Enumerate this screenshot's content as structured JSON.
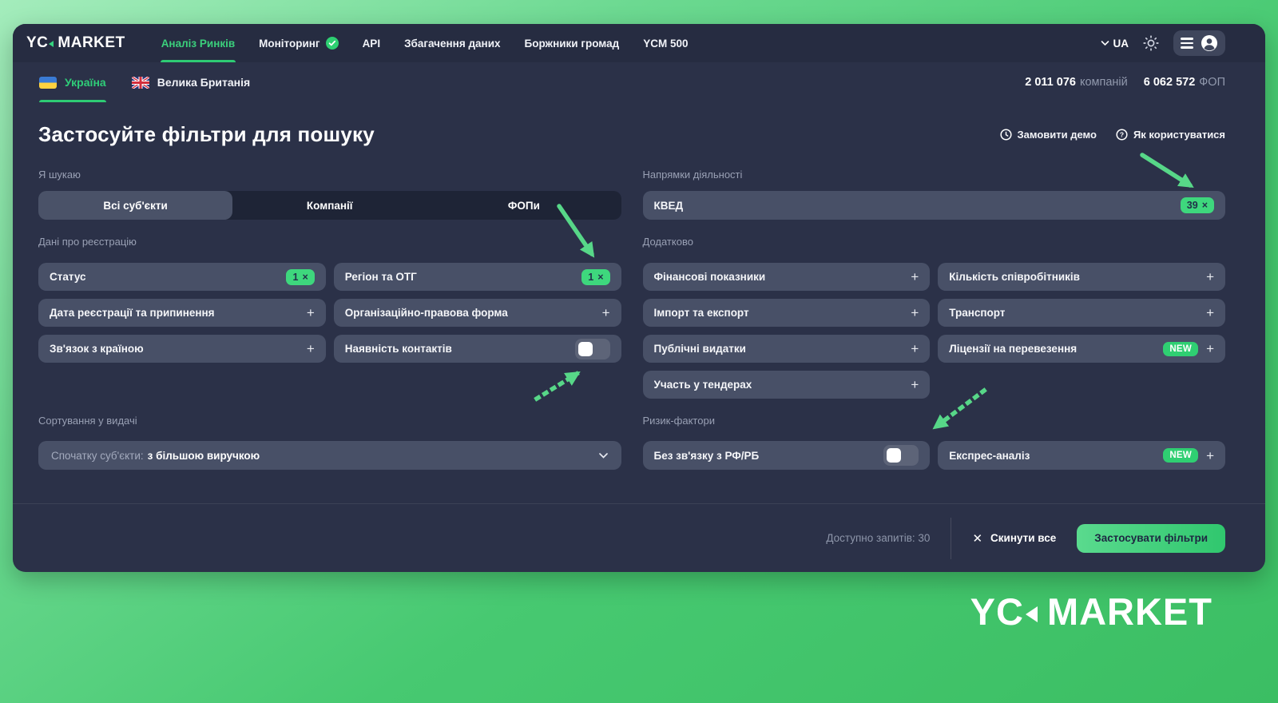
{
  "colors": {
    "accent": "#2ecb74",
    "badge": "#3ed77d",
    "card": "#2b3148",
    "button": "#485067"
  },
  "icons": {
    "plus": "+",
    "close": "×",
    "reset_x": "✕"
  },
  "brand": {
    "yc": "YC",
    "market": "MARKET"
  },
  "navbar": {
    "items": [
      {
        "label": "Аналіз Ринків"
      },
      {
        "label": "Моніторинг"
      },
      {
        "label": "API"
      },
      {
        "label": "Збагачення даних"
      },
      {
        "label": "Боржники громад"
      },
      {
        "label": "YCM 500"
      }
    ],
    "language": "UA"
  },
  "country_bar": {
    "countries": [
      {
        "label": "Україна"
      },
      {
        "label": "Велика Британія"
      }
    ],
    "stats": [
      {
        "value": "2 011 076",
        "unit": "компаній"
      },
      {
        "value": "6 062 572",
        "unit": "ФОП"
      }
    ]
  },
  "header": {
    "title": "Застосуйте фільтри для пошуку",
    "links": [
      {
        "label": "Замовити демо"
      },
      {
        "label": "Як користуватися"
      }
    ]
  },
  "search_type": {
    "label": "Я шукаю",
    "options": [
      {
        "label": "Всі суб'єкти"
      },
      {
        "label": "Компанії"
      },
      {
        "label": "ФОПи"
      }
    ]
  },
  "registration": {
    "label": "Дані про реєстрацію",
    "filters": [
      {
        "label": "Статус",
        "count": "1"
      },
      {
        "label": "Регіон та ОТГ",
        "count": "1"
      },
      {
        "label": "Дата реєстрації та припинення"
      },
      {
        "label": "Організаційно-правова форма"
      },
      {
        "label": "Зв'язок з країною"
      },
      {
        "label": "Наявність контактів",
        "toggle": "off"
      }
    ]
  },
  "sorting": {
    "label": "Сортування у видачі",
    "value_prefix": "Спочатку суб'єкти:",
    "value": "з більшою виручкою"
  },
  "activity": {
    "label": "Напрямки діяльності",
    "filter": {
      "label": "КВЕД",
      "count": "39"
    }
  },
  "additional": {
    "label": "Додатково",
    "filters": [
      {
        "label": "Фінансові показники"
      },
      {
        "label": "Кількість співробітників"
      },
      {
        "label": "Імпорт та експорт"
      },
      {
        "label": "Транспорт"
      },
      {
        "label": "Публічні видатки"
      },
      {
        "label": "Ліцензії на перевезення",
        "badge": "NEW"
      },
      {
        "label": "Участь у тендерах"
      }
    ]
  },
  "risk": {
    "label": "Ризик-фактори",
    "filters": [
      {
        "label": "Без зв'язку з РФ/РБ",
        "toggle": "off"
      },
      {
        "label": "Експрес-аналіз",
        "badge": "NEW"
      }
    ]
  },
  "footer": {
    "quota": "Доступно запитів: 30",
    "reset": "Скинути все",
    "apply": "Застосувати фільтри"
  }
}
